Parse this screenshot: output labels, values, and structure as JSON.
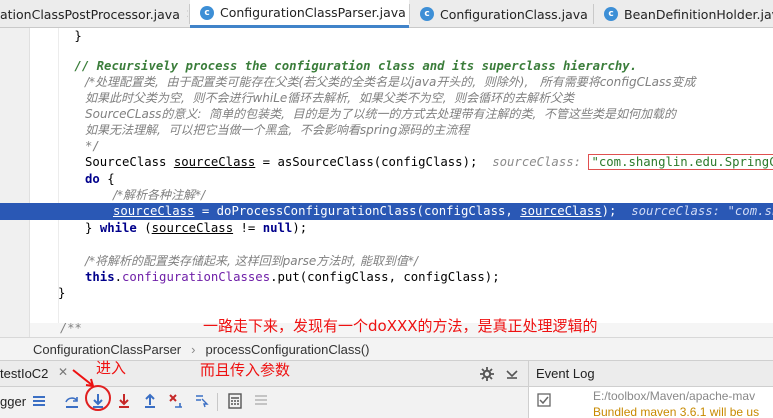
{
  "tabs": [
    {
      "label": "ationClassPostProcessor.java",
      "active": false
    },
    {
      "label": "ConfigurationClassParser.java",
      "active": true
    },
    {
      "label": "ConfigurationClass.java",
      "active": false
    },
    {
      "label": "BeanDefinitionHolder.java",
      "active": false
    }
  ],
  "code": {
    "brace_close": "}",
    "comment_en": "// Recursively process the configuration class and its superclass hierarchy.",
    "comment_cn1": "/*处理配置类,  由于配置类可能存在父类(若父类的全类名是以java开头的,  则除外),   所有需要将configCLass变成",
    "comment_cn2": "如果此时父类为空,  则不会进行whiLe循环去解析,  如果父类不为空,  则会循环的去解析父类",
    "comment_cn3": "SourceCLass的意义:  简单的包装类,  目的是为了以统一的方式去处理带有注解的类,  不管这些类是如何加载的",
    "comment_cn4": "如果无法理解,  可以把它当做一个黑盒,  不会影响看spring源码的主流程",
    "comment_end": "*/",
    "decl_type": "SourceClass ",
    "decl_var": "sourceClass",
    "decl_rest": " = asSourceClass(configClass);  ",
    "decl_hint": "sourceClass: ",
    "decl_hint_value": "\"com.shanglin.edu.SpringConfig",
    "do_kw": "do",
    "do_brace": " {",
    "inner_comment": "/*解析各种注解*/",
    "hl_var": "sourceClass",
    "hl_mid": " = doProcessConfigurationClass(configClass, ",
    "hl_var2": "sourceClass",
    "hl_end": ");  ",
    "hl_hint": "sourceClass: \"com.shangli",
    "while_close": "} ",
    "while_kw": "while",
    "while_open": " (",
    "while_var": "sourceClass",
    "while_rest": " != ",
    "while_null": "null",
    "while_end": ");",
    "store_comment": "/*将解析的配置类存储起来, 这样回到parse方法时, 能取到值*/",
    "this_kw": "this",
    "this_dot": ".",
    "this_field": "configurationClasses",
    "this_rest": ".put(configClass, configClass);",
    "method_close": "}",
    "folded": "/**"
  },
  "breadcrumb": {
    "class_name": "ConfigurationClassParser",
    "separator": "›",
    "method_name": "processConfigurationClass()"
  },
  "debug_panel": {
    "tab_label": "testIoC2",
    "side_label": "gger"
  },
  "event_log": {
    "title": "Event Log",
    "line1": "E:/toolbox/Maven/apache-mav",
    "line2": "Bundled maven 3.6.1 will be us"
  },
  "annotations": {
    "note_main": "一路走下来，发现有一个doXXX的方法，是真正处理逻辑的",
    "note_enter": "进入",
    "note_param": "而且传入参数"
  },
  "colors": {
    "accent": "#2a58b5",
    "annotation": "#ee1111",
    "keyword": "#00008b",
    "comment_green": "#3a7d3a"
  }
}
